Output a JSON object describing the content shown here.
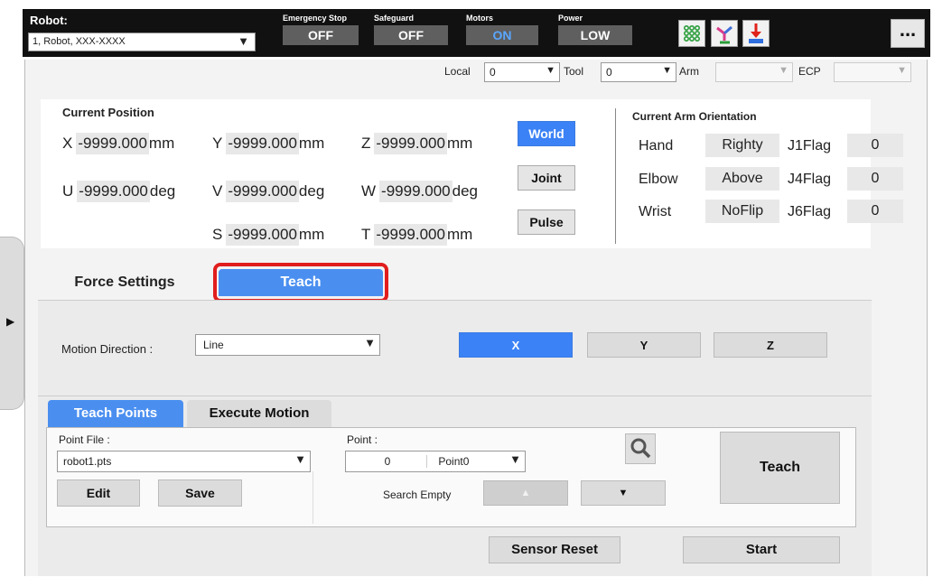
{
  "topbar": {
    "robot_label": "Robot:",
    "robot_value": "1, Robot, XXX-XXXX",
    "status": [
      {
        "caption": "Emergency Stop",
        "value": "OFF"
      },
      {
        "caption": "Safeguard",
        "value": "OFF"
      },
      {
        "caption": "Motors",
        "value": "ON"
      },
      {
        "caption": "Power",
        "value": "LOW"
      }
    ],
    "icons": [
      "io-grid-icon",
      "robot-arm-icon",
      "home-download-icon"
    ],
    "more_label": "..."
  },
  "selectors": {
    "local_label": "Local",
    "local_value": "0",
    "tool_label": "Tool",
    "tool_value": "0",
    "arm_label": "Arm",
    "arm_value": "",
    "ecp_label": "ECP",
    "ecp_value": ""
  },
  "position": {
    "title": "Current Position",
    "X": "-9999.000",
    "X_unit": "mm",
    "Y": "-9999.000",
    "Y_unit": "mm",
    "Z": "-9999.000",
    "Z_unit": "mm",
    "U": "-9999.000",
    "U_unit": "deg",
    "V": "-9999.000",
    "V_unit": "deg",
    "W": "-9999.000",
    "W_unit": "deg",
    "S": "-9999.000",
    "S_unit": "mm",
    "T": "-9999.000",
    "T_unit": "mm",
    "frames": [
      "World",
      "Joint",
      "Pulse"
    ],
    "active_frame": "World"
  },
  "orientation": {
    "title": "Current Arm Orientation",
    "rows": [
      {
        "label": "Hand",
        "value": "Righty",
        "flag": "J1Flag",
        "flag_value": "0"
      },
      {
        "label": "Elbow",
        "value": "Above",
        "flag": "J4Flag",
        "flag_value": "0"
      },
      {
        "label": "Wrist",
        "value": "NoFlip",
        "flag": "J6Flag",
        "flag_value": "0"
      }
    ]
  },
  "tabs": {
    "force": "Force Settings",
    "teach": "Teach"
  },
  "motion": {
    "label": "Motion Direction :",
    "value": "Line",
    "directions": [
      "X",
      "Y",
      "Z"
    ],
    "active": "X"
  },
  "subtabs": {
    "teach_points": "Teach Points",
    "execute": "Execute Motion"
  },
  "teach_points": {
    "point_file_label": "Point File :",
    "point_file_value": "robot1.pts",
    "point_label": "Point :",
    "point_number": "0",
    "point_name": "Point0",
    "edit": "Edit",
    "save": "Save",
    "search_empty": "Search Empty",
    "up": "▲",
    "down": "▼",
    "teach_button": "Teach"
  },
  "footer": {
    "sensor_reset": "Sensor Reset",
    "start": "Start"
  },
  "colors": {
    "accent": "#4a8ff0",
    "highlight": "#e11d1d",
    "topbar": "#111111"
  }
}
